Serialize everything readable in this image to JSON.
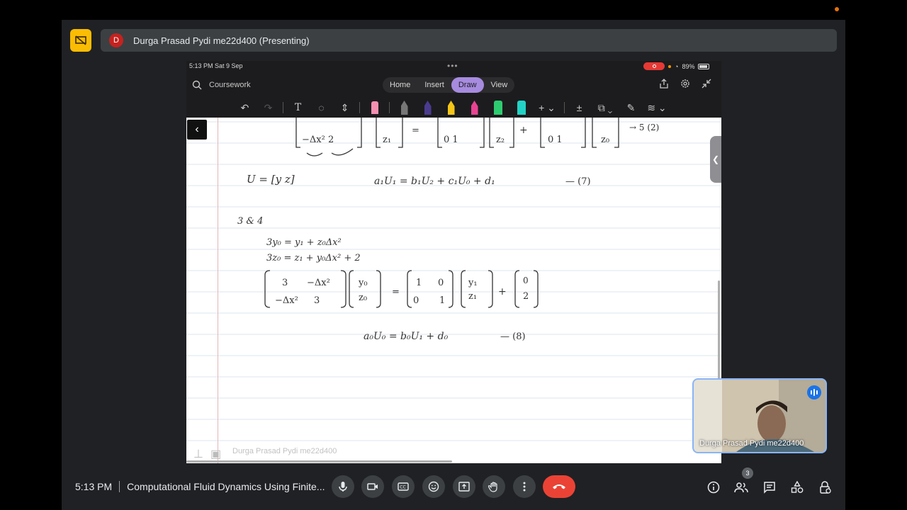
{
  "presenter": {
    "avatar_letter": "D",
    "banner_text": "Durga Prasad Pydi me22d400 (Presenting)"
  },
  "ipad": {
    "status_time": "5:13 PM   Sat 9 Sep",
    "battery": "89%",
    "notebook": "Coursework",
    "tabs": [
      "Home",
      "Insert",
      "Draw",
      "View"
    ],
    "active_tab": "Draw",
    "footer_name": "Durga Prasad Pydi me22d400"
  },
  "notes": {
    "top_row_left": "−Δx²   2",
    "top_row_z": "z₁",
    "top_row_eq": "=",
    "top_row_m": "0   1",
    "top_row_z2": "z₂",
    "top_row_plus": "+",
    "top_row_m2": "0   1",
    "top_row_z0": "z₀",
    "top_row_tag": "→ 5 (2)",
    "u_def": "U = [y  z]",
    "eq7": "a₁U₁  =  b₁U₂ + c₁U₀ + d₁",
    "eq7_tag": "— (7)",
    "case": "3 & 4",
    "line1": "3y₀  =   y₁ + z₀Δx²",
    "line2": "3z₀  =   z₁ +  y₀Δx² + 2",
    "mat_a": [
      "3",
      "−Δx²",
      "−Δx²",
      "3"
    ],
    "vec_y": [
      "y₀",
      "z₀"
    ],
    "mat_i": [
      "1",
      "0",
      "0",
      "1"
    ],
    "vec_y1": [
      "y₁",
      "z₁"
    ],
    "vec_c": [
      "0",
      "2"
    ],
    "eq8": "a₀U₀   =   b₀U₁ + d₀",
    "eq8_tag": "— (8)"
  },
  "selfview": {
    "name": "Durga Prasad Pydi me22d400"
  },
  "meeting": {
    "time": "5:13 PM",
    "title": "Computational Fluid Dynamics Using Finite...",
    "participant_count": "3"
  },
  "colors": {
    "meet_bg": "#202124",
    "present_icon": "#fbbc04",
    "end_call": "#ea4335",
    "draw_tab": "#a78bdf",
    "ink": "#333333"
  }
}
